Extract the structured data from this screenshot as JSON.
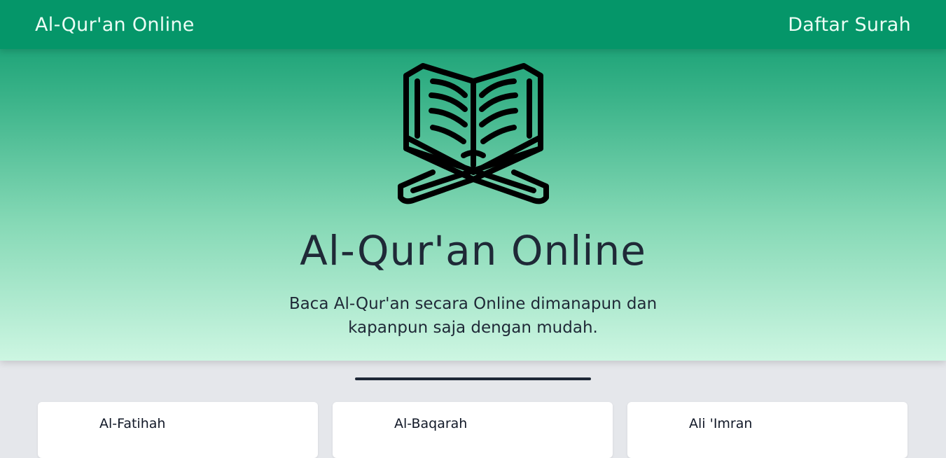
{
  "navbar": {
    "brand": "Al-Qur'an Online",
    "link": "Daftar Surah"
  },
  "hero": {
    "icon": "quran-on-stand-icon",
    "title": "Al-Qur'an Online",
    "subtitle": "Baca Al-Qur'an secara Online dimanapun dan kapanpun saja dengan mudah."
  },
  "surahs": [
    {
      "name": "Al-Fatihah"
    },
    {
      "name": "Al-Baqarah"
    },
    {
      "name": "Ali 'Imran"
    }
  ],
  "colors": {
    "navbar": "#059669",
    "hero_top": "#059669",
    "hero_bottom": "#cdf6e2",
    "text_dark": "#1f2937",
    "page_bg": "#e5e7eb"
  }
}
